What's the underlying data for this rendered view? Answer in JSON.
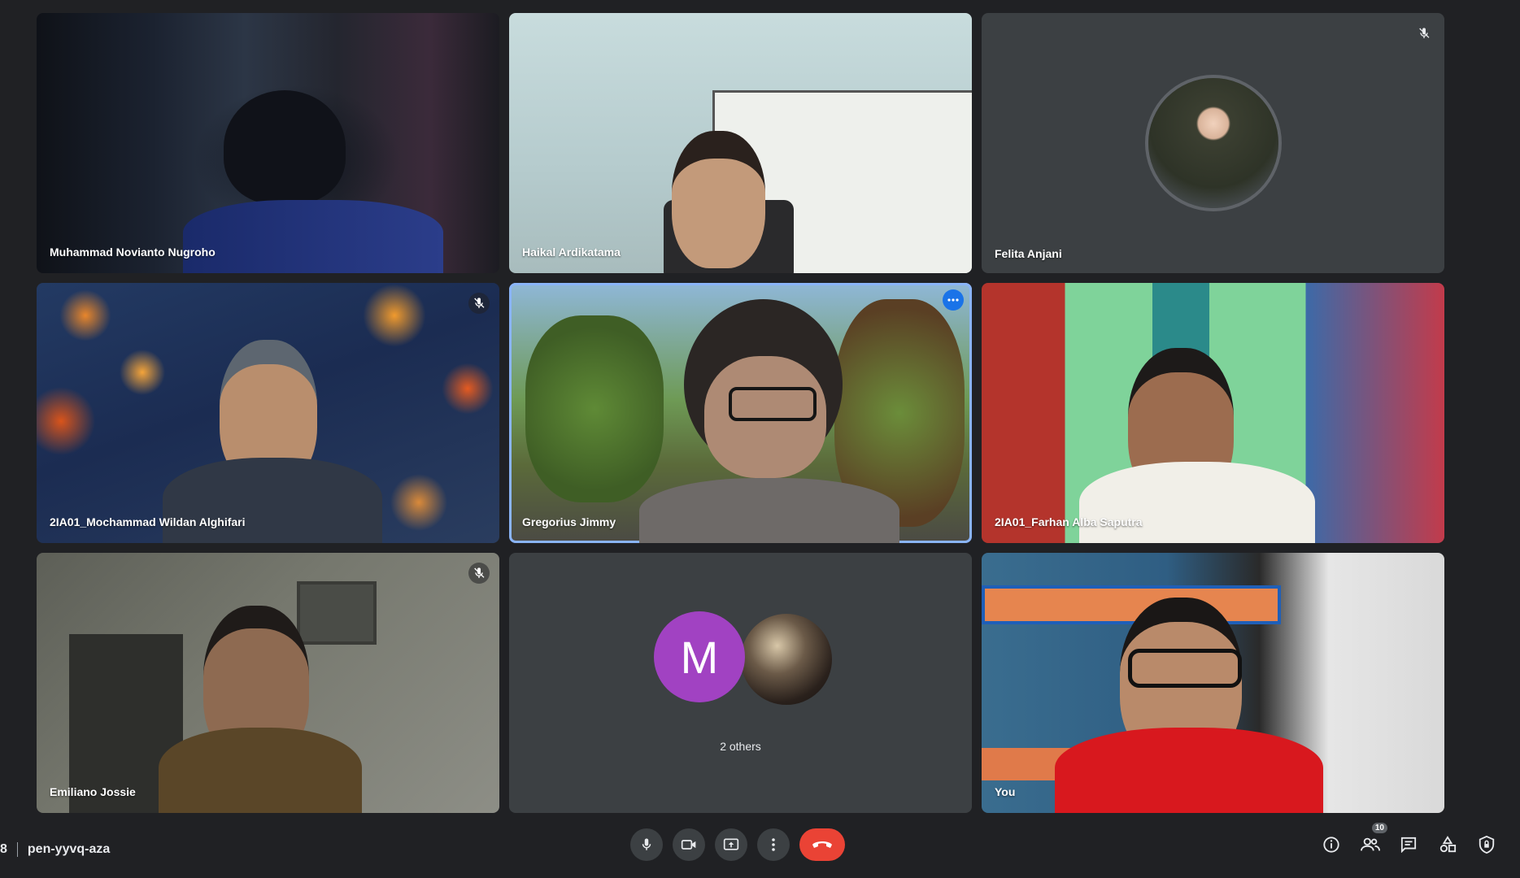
{
  "participants": [
    {
      "name": "Muhammad Novianto Nugroho",
      "muted": false
    },
    {
      "name": "Haikal Ardikatama",
      "muted": false
    },
    {
      "name": "Felita Anjani",
      "muted": true
    },
    {
      "name": "2IA01_Mochammad Wildan Alghifari",
      "muted": true
    },
    {
      "name": "Gregorius Jimmy",
      "muted": false,
      "active_speaker": true
    },
    {
      "name": "2IA01_Farhan Alba Saputra",
      "muted": false
    },
    {
      "name": "Emiliano Jossie",
      "muted": true
    },
    {
      "name": "You",
      "muted": false
    }
  ],
  "others_tile": {
    "avatar_letter": "M",
    "label": "2 others",
    "avatar_color": "#a142c2"
  },
  "meeting": {
    "time_fragment": "8",
    "code": "pen-yyvq-aza"
  },
  "people_count": "10",
  "colors": {
    "background": "#202124",
    "tile": "#3c4043",
    "end_call": "#ea4335",
    "active_outline": "#8ab4f8"
  }
}
